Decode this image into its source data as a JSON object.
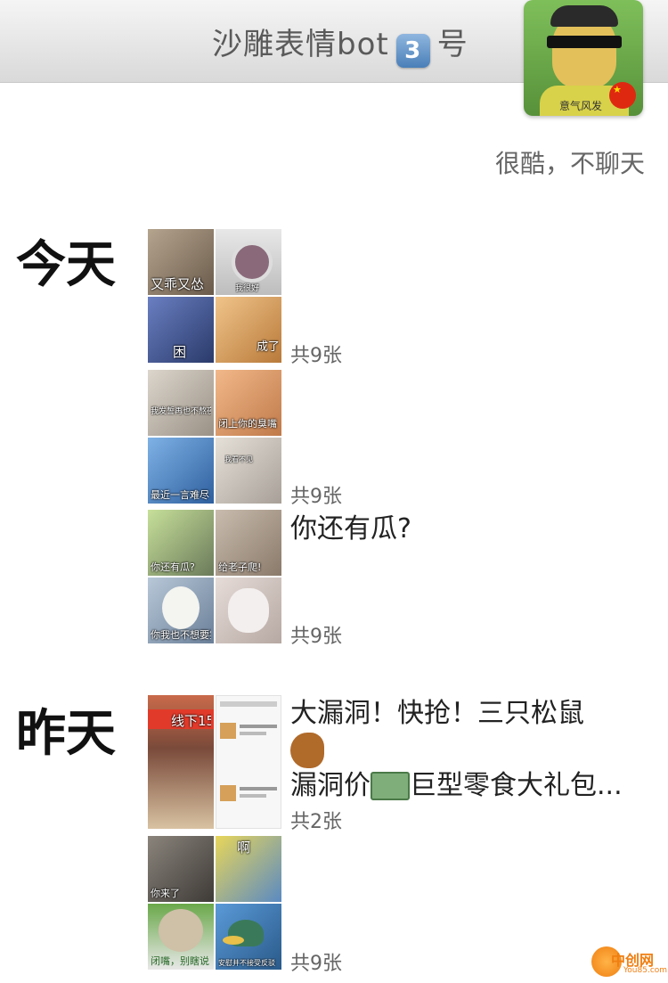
{
  "header": {
    "title_prefix": "沙雕表情bot",
    "badge_number": "3",
    "title_suffix": "号"
  },
  "profile": {
    "avatar_caption": "意气风发",
    "motto": "很酷，不聊天"
  },
  "sections": {
    "today": {
      "label": "今天",
      "posts": [
        {
          "tiles": [
            {
              "caption": "又乖又怂",
              "color": "#8a7a6a"
            },
            {
              "caption": "我很好",
              "color": "#cfcfcf"
            },
            {
              "caption": "困",
              "color": "#3b4e8a"
            },
            {
              "caption": "成了",
              "color": "#d49a5a"
            }
          ],
          "count": "共9张"
        },
        {
          "tiles": [
            {
              "caption": "我发誓再也不熬夜了",
              "color": "#bdb5aa"
            },
            {
              "caption": "闭上你的臭嘴",
              "color": "#d99a6a"
            },
            {
              "caption": "最近一言难尽",
              "color": "#4a7fc2"
            },
            {
              "caption": "我看不见",
              "color": "#cfcac2"
            }
          ],
          "count": "共9张"
        },
        {
          "tiles": [
            {
              "caption": "你还有瓜?",
              "color": "#8d8a7a"
            },
            {
              "caption": "给老子爬!",
              "color": "#b4a596"
            },
            {
              "caption": "你我也不想要笑",
              "color": "#8aa0b8"
            },
            {
              "caption": "",
              "color": "#cfc2bd"
            }
          ],
          "message": "你还有瓜?",
          "count": "共9张"
        }
      ]
    },
    "yesterday": {
      "label": "昨天",
      "posts": [
        {
          "tiles": [
            {
              "caption": "线下158",
              "color": "#a85a3a"
            },
            {
              "caption": "",
              "color": "#f2f2f2"
            }
          ],
          "message_line1": "大漏洞！快抢！三只松鼠",
          "message_line3_prefix": "漏洞价",
          "message_line3_suffix": "巨型零食大礼包...",
          "emoji_squirrel": "squirrel",
          "emoji_money": "money-bag",
          "count": "共2张"
        },
        {
          "tiles": [
            {
              "caption": "你来了",
              "color": "#5a5550"
            },
            {
              "caption": "啊",
              "color": "#d9c24a"
            },
            {
              "caption": "闭嘴，别瞎说",
              "color": "#3a7a3a"
            },
            {
              "caption": "安慰并不接受反驳",
              "color": "#3b6ea0"
            }
          ],
          "count": "共9张"
        }
      ]
    }
  },
  "watermark": {
    "text": "中创网",
    "sub": "You85.com"
  }
}
